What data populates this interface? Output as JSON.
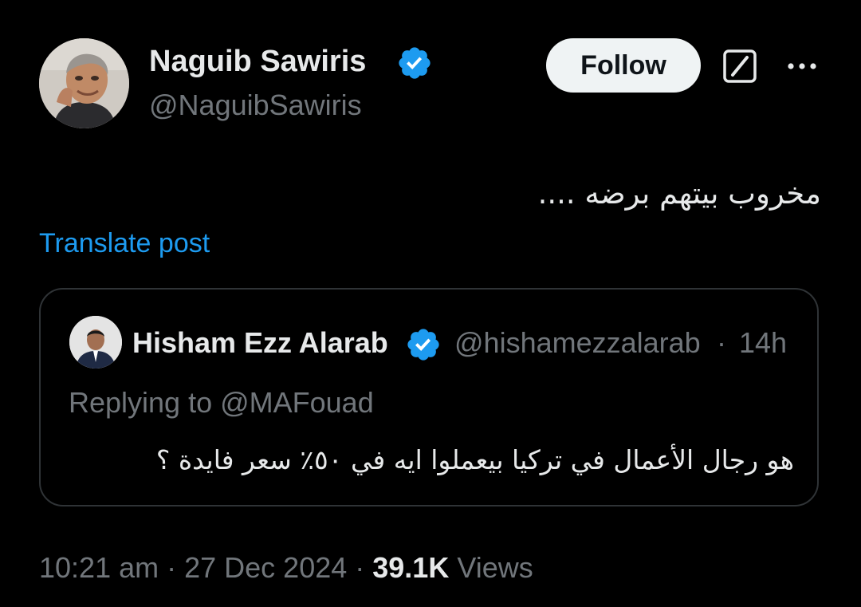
{
  "author": {
    "name": "Naguib Sawiris",
    "handle": "@NaguibSawiris"
  },
  "follow_label": "Follow",
  "post": {
    "text": "مخروب بيتهم برضه ....",
    "translate_label": "Translate post"
  },
  "quoted_post": {
    "author_name": "Hisham Ezz Alarab",
    "author_handle": "@hishamezzalarab",
    "dot": "·",
    "time": "14h",
    "replying_to": "Replying to @MAFouad",
    "text": "هو رجال الأعمال في تركيا بيعملوا ايه في ٥٠٪ سعر فايدة ؟"
  },
  "meta": {
    "time": "10:21 am",
    "separator": " · ",
    "date": "27 Dec 2024",
    "views_count": "39.1K",
    "views_label": "Views"
  },
  "icons": {
    "verified": "verified-badge-icon",
    "grok": "grok-icon",
    "more": "more-horizontal-icon"
  },
  "colors": {
    "background": "#000000",
    "text_primary": "#e7e9ea",
    "text_secondary": "#71767b",
    "link": "#1d9bf0",
    "verified": "#1d9bf0",
    "border": "#2f3336",
    "follow_bg": "#eff3f4"
  }
}
